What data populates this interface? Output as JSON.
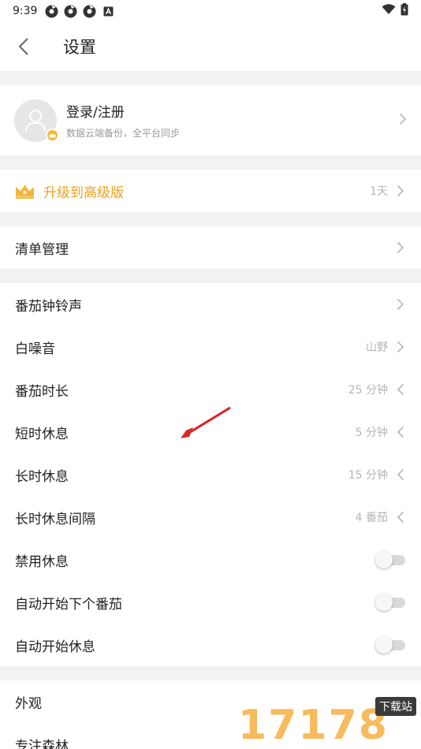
{
  "status_bar": {
    "time": "9:39"
  },
  "header": {
    "title": "设置"
  },
  "profile": {
    "name": "登录/注册",
    "subtitle": "数据云端备份，全平台同步"
  },
  "upgrade": {
    "label": "升级到高级版",
    "value": "1天"
  },
  "list_management": {
    "label": "清单管理"
  },
  "timer_settings": [
    {
      "label": "番茄钟铃声",
      "value": ""
    },
    {
      "label": "白噪音",
      "value": "山野"
    },
    {
      "label": "番茄时长",
      "value": "25 分钟"
    },
    {
      "label": "短时休息",
      "value": "5 分钟"
    },
    {
      "label": "长时休息",
      "value": "15 分钟"
    },
    {
      "label": "长时休息间隔",
      "value": "4 番茄"
    }
  ],
  "toggles": [
    {
      "label": "禁用休息",
      "on": false
    },
    {
      "label": "自动开始下个番茄",
      "on": false
    },
    {
      "label": "自动开始休息",
      "on": false
    }
  ],
  "other": [
    {
      "label": "外观"
    },
    {
      "label": "专注森林"
    }
  ],
  "watermark": {
    "digits": "17178",
    "tag": "下载站"
  },
  "colors": {
    "accent": "#f0a01a",
    "value_gray": "#b5b5b5",
    "background": "#f2f2f2"
  }
}
